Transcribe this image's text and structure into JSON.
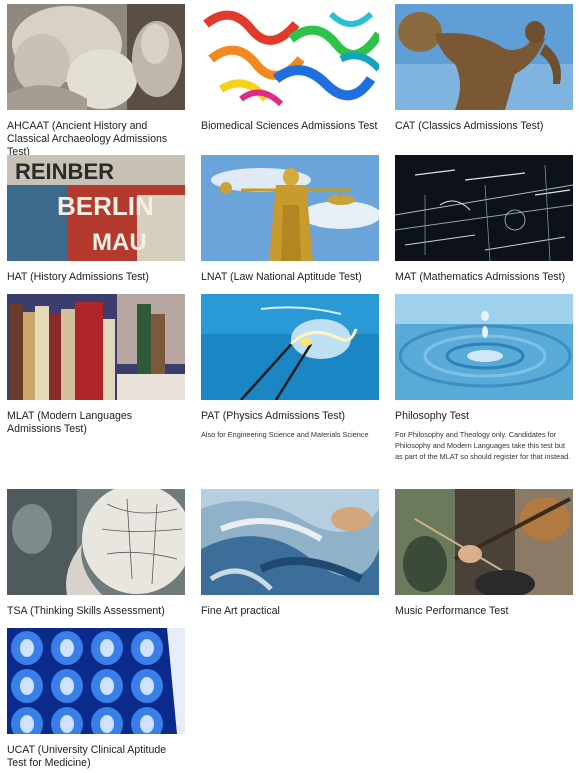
{
  "tests": [
    {
      "title": "AHCAAT (Ancient History and Classical Archaeology Admissions Test)",
      "description": "",
      "image": "classical-sculpture-image"
    },
    {
      "title": "Biomedical Sciences Admissions Test",
      "description": "",
      "image": "protein-structure-image"
    },
    {
      "title": "CAT (Classics Admissions Test)",
      "description": "",
      "image": "discus-thrower-statue-image"
    },
    {
      "title": "HAT (History Admissions Test)",
      "description": "",
      "image": "berlin-wall-graffiti-image"
    },
    {
      "title": "LNAT (Law National Aptitude Test)",
      "description": "",
      "image": "lady-justice-statue-image"
    },
    {
      "title": "MAT (Mathematics Admissions Test)",
      "description": "",
      "image": "chalkboard-equations-image"
    },
    {
      "title": "MLAT (Modern Languages Admissions Test)",
      "description": "",
      "image": "books-on-shelf-image"
    },
    {
      "title": "PAT (Physics Admissions Test)",
      "description": "Also for Engineering Science and Materials Science",
      "image": "light-bulb-filament-image"
    },
    {
      "title": "Philosophy Test",
      "description": "For Philosophy and Theology only. Candidates for Philosophy and Modern Languages take this test but as part of the MLAT so should register for that instead.",
      "image": "water-droplet-ripple-image"
    },
    {
      "title": "TSA (Thinking Skills Assessment)",
      "description": "",
      "image": "phrenology-head-image"
    },
    {
      "title": "Fine Art practical",
      "description": "",
      "image": "abstract-painting-image"
    },
    {
      "title": "Music Performance Test",
      "description": "",
      "image": "violin-player-image"
    },
    {
      "title": "UCAT (University Clinical Aptitude Test for Medicine)",
      "description": "",
      "image": "brain-scan-image"
    }
  ]
}
